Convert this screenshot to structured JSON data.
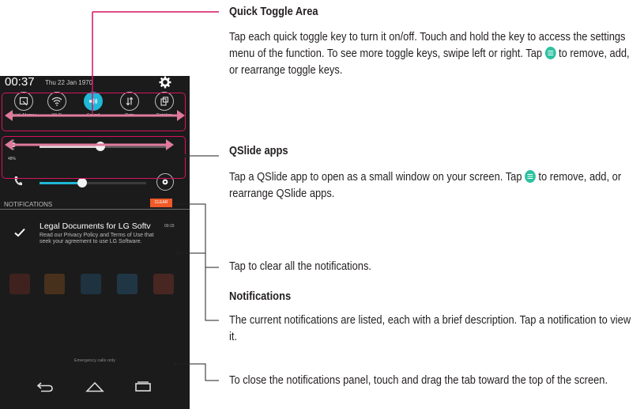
{
  "phone": {
    "clock": "00:37",
    "date": "Thu 22 Jan 1970",
    "toggles": [
      {
        "label": "Quick Memo+",
        "icon": "quick-memo-icon",
        "active": false
      },
      {
        "label": "Wi-Fi",
        "icon": "wifi-icon",
        "active": false
      },
      {
        "label": "Sound",
        "icon": "sound-icon",
        "active": true
      },
      {
        "label": "Data",
        "icon": "data-icon",
        "active": false
      },
      {
        "label": "Rotation",
        "icon": "rotation-icon",
        "active": false
      }
    ],
    "brightness_percent": "48%",
    "brightness_level": 0.48,
    "volume_level": 0.4,
    "notifications_header": "NOTIFICATIONS",
    "clear_label": "CLEAR",
    "notification": {
      "title": "Legal Documents for LG Softv",
      "time": "00:15",
      "description": "Read our Privacy Policy and Terms of Use that seek your agreement to use LG Software."
    },
    "emergency_text": "Emergency calls only",
    "accent_color": "#20b8d8",
    "clear_color": "#f05a28"
  },
  "callouts": [
    {
      "heading": "Quick Toggle Area",
      "description_before": "Tap each quick toggle key to turn it on/off. Touch and hold the key to access the settings menu of the function. To see more toggle keys, swipe left or right. Tap",
      "description_after": "to remove, add, or rearrange toggle keys."
    },
    {
      "heading": "QSlide apps",
      "description_before": "Tap a QSlide app to open as a small window on your screen. Tap",
      "description_after": "to remove, add, or rearrange QSlide apps."
    },
    {
      "description": "Tap to clear all the notifications."
    },
    {
      "heading": "Notifications",
      "description": "The current notifications are listed, each with a brief description. Tap a notification to view it."
    },
    {
      "description": "To close the notifications panel, touch and drag the tab toward the top of the screen."
    }
  ],
  "callout_color": "#d6145f",
  "edit_icon_color": "#2dc1a0"
}
